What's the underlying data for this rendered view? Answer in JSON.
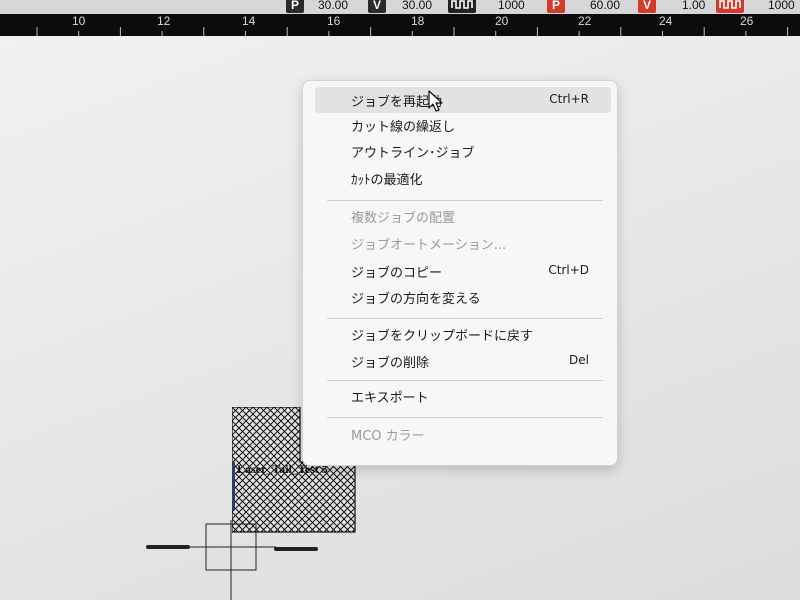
{
  "toolbar": {
    "items": [
      {
        "icon": "p",
        "value": "30.00"
      },
      {
        "icon": "v",
        "value": "30.00"
      },
      {
        "icon": "wave",
        "value": "1000"
      },
      {
        "icon": "p",
        "value": "60.00"
      },
      {
        "icon": "v",
        "value": "1.00"
      },
      {
        "icon": "wave",
        "value": "1000"
      }
    ],
    "p_label": "P",
    "v_label": "V",
    "colors": {
      "p_box": "#d23a2a",
      "v_box": "#2a2a2a",
      "wave_box_dark": "#222222",
      "wave_box_red": "#d23a2a"
    }
  },
  "ruler": {
    "labels": [
      "10",
      "12",
      "14",
      "16",
      "18",
      "20",
      "22",
      "24",
      "26"
    ]
  },
  "job": {
    "label": "Laser_Tail_Test 5"
  },
  "context_menu": {
    "items": [
      {
        "label": "ジョブを再起動",
        "shortcut": "Ctrl+R",
        "enabled": true,
        "hover": true
      },
      {
        "label": "カット線の繰返し",
        "shortcut": "",
        "enabled": true
      },
      {
        "label": "アウトライン･ジョブ",
        "shortcut": "",
        "enabled": true
      },
      {
        "label": "ｶｯﾄの最適化",
        "shortcut": "",
        "enabled": true
      },
      {
        "label": "複数ジョブの配置",
        "shortcut": "",
        "enabled": false
      },
      {
        "label": "ジョブオートメーション...",
        "shortcut": "",
        "enabled": false
      },
      {
        "label": "ジョブのコピー",
        "shortcut": "Ctrl+D",
        "enabled": true
      },
      {
        "label": "ジョブの方向を変える",
        "shortcut": "",
        "enabled": true
      },
      {
        "label": "ジョブをクリップボードに戻す",
        "shortcut": "",
        "enabled": true
      },
      {
        "label": "ジョブの削除",
        "shortcut": "Del",
        "enabled": true
      },
      {
        "label": "エキスポート",
        "shortcut": "",
        "enabled": true
      },
      {
        "label": "MCO カラー",
        "shortcut": "",
        "enabled": false
      }
    ]
  }
}
